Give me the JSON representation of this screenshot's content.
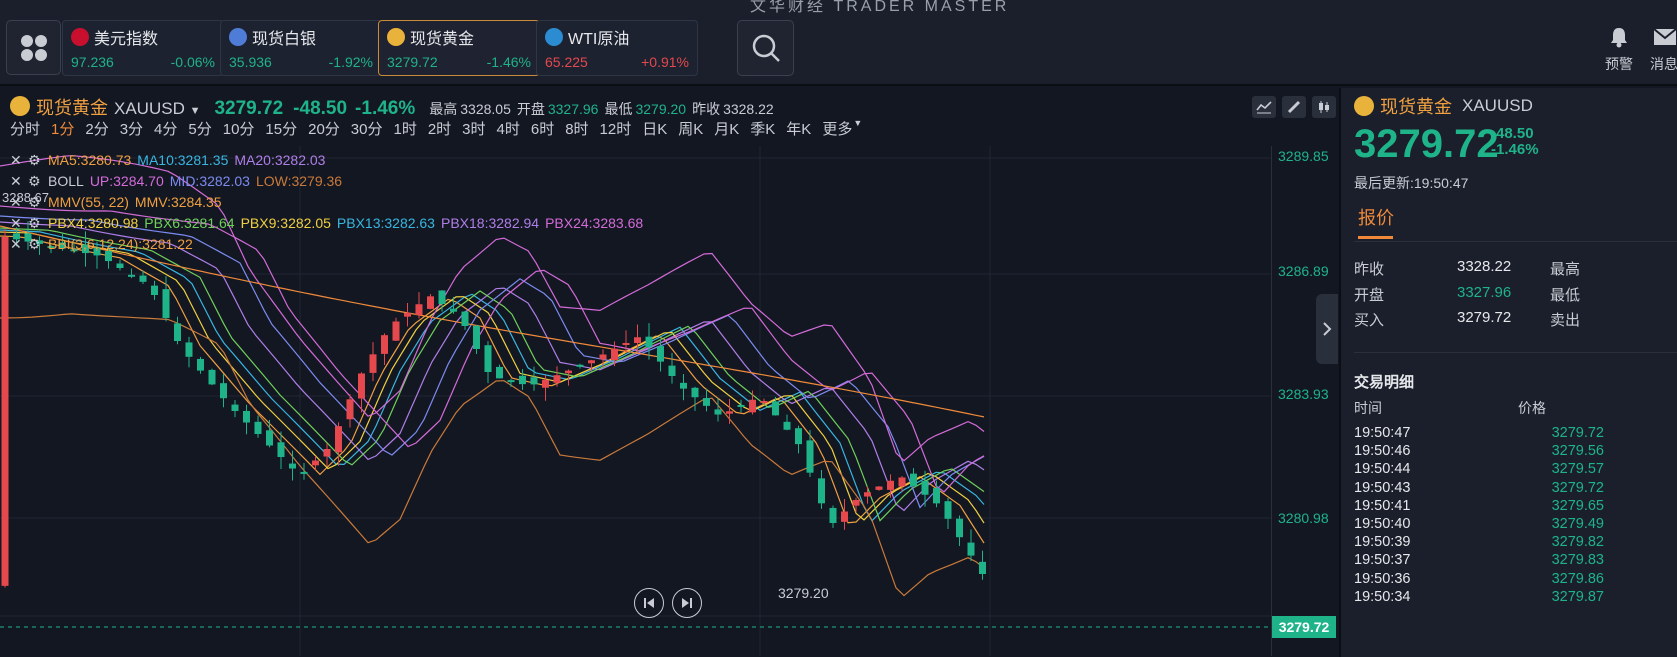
{
  "app": {
    "title": "文华财经 TRADER MASTER"
  },
  "tickers": [
    {
      "name": "美元指数",
      "price": "97.236",
      "change": "-0.06%",
      "flag_color": "#c8102e",
      "active": false
    },
    {
      "name": "现货白银",
      "price": "35.936",
      "change": "-1.92%",
      "flag_color": "#4f7cd6",
      "active": false
    },
    {
      "name": "现货黄金",
      "price": "3279.72",
      "change": "-1.46%",
      "flag_color": "#e9b23a",
      "active": true
    },
    {
      "name": "WTI原油",
      "price": "65.225",
      "change": "+0.91%",
      "flag_color": "#2b8cd1",
      "active": false
    }
  ],
  "header": {
    "alert_label": "预警",
    "message_label": "消息"
  },
  "chart": {
    "symbol_name": "现货黄金",
    "symbol_code": "XAUUSD",
    "price": "3279.72",
    "change": "-48.50",
    "change_pct": "-1.46%",
    "high_label": "最高",
    "high": "3328.05",
    "open_label": "开盘",
    "open": "3327.96",
    "low_label": "最低",
    "low": "3279.20",
    "prev_label": "昨收",
    "prev": "3328.22",
    "timeframes": [
      "分时",
      "1分",
      "2分",
      "3分",
      "4分",
      "5分",
      "10分",
      "15分",
      "20分",
      "30分",
      "1时",
      "2时",
      "3时",
      "4时",
      "6时",
      "8时",
      "12时",
      "日K",
      "周K",
      "月K",
      "季K",
      "年K",
      "更多"
    ],
    "selected_timeframe": "1分",
    "indicators": {
      "ma": [
        {
          "text": "MA5:3280.73",
          "color": "#f0a040"
        },
        {
          "text": "MA10:3281.35",
          "color": "#38b6e0"
        },
        {
          "text": "MA20:3282.03",
          "color": "#b07ee8"
        }
      ],
      "boll": {
        "label": "BOLL",
        "items": [
          {
            "text": "UP:3284.70",
            "color": "#d36bd8"
          },
          {
            "text": "MID:3282.03",
            "color": "#7c8bf0"
          },
          {
            "text": "LOW:3279.36",
            "color": "#c97a3a"
          }
        ]
      },
      "mmv": [
        {
          "text": "MMV(55, 22)",
          "color": "#f0a040"
        },
        {
          "text": "MMV:3284.35",
          "color": "#f0a040"
        }
      ],
      "pbx": [
        {
          "text": "PBX4:3280.98",
          "color": "#f0d040"
        },
        {
          "text": "PBX6:3281.64",
          "color": "#6fd05a"
        },
        {
          "text": "PBX9:3282.05",
          "color": "#f0d040"
        },
        {
          "text": "PBX13:3282.63",
          "color": "#38b6e0"
        },
        {
          "text": "PBX18:3282.94",
          "color": "#b07ee8"
        },
        {
          "text": "PBX24:3283.68",
          "color": "#d36bd8"
        }
      ],
      "bbi": {
        "text": "BBI(3,6,12,24):3281.22",
        "color": "#f0a040"
      },
      "left_marker": "3288.67"
    },
    "price_axis": [
      "3289.85",
      "3286.89",
      "3283.93",
      "3280.98"
    ],
    "current_tag": "3279.72",
    "low_marker": "3279.20"
  },
  "quote_panel": {
    "symbol_name": "现货黄金",
    "symbol_code": "XAUUSD",
    "price": "3279.72",
    "change": "-48.50",
    "change_pct": "-1.46%",
    "last_update": "最后更新:19:50:47",
    "tab": "报价",
    "stats": [
      {
        "label": "昨收",
        "value": "3328.22",
        "green": false,
        "label2": "最高"
      },
      {
        "label": "开盘",
        "value": "3327.96",
        "green": true,
        "label2": "最低"
      },
      {
        "label": "买入",
        "value": "3279.72",
        "green": false,
        "label2": "卖出"
      }
    ],
    "trade_title": "交易明细",
    "col_time": "时间",
    "col_price": "价格",
    "trades": [
      {
        "time": "19:50:47",
        "price": "3279.72"
      },
      {
        "time": "19:50:46",
        "price": "3279.56"
      },
      {
        "time": "19:50:44",
        "price": "3279.57"
      },
      {
        "time": "19:50:43",
        "price": "3279.72"
      },
      {
        "time": "19:50:41",
        "price": "3279.65"
      },
      {
        "time": "19:50:40",
        "price": "3279.49"
      },
      {
        "time": "19:50:39",
        "price": "3279.82"
      },
      {
        "time": "19:50:37",
        "price": "3279.83"
      },
      {
        "time": "19:50:36",
        "price": "3279.86"
      },
      {
        "time": "19:50:34",
        "price": "3279.87"
      }
    ]
  },
  "colors": {
    "up": "#e5484d",
    "down": "#1fb38a",
    "accent": "#f08a3a"
  }
}
